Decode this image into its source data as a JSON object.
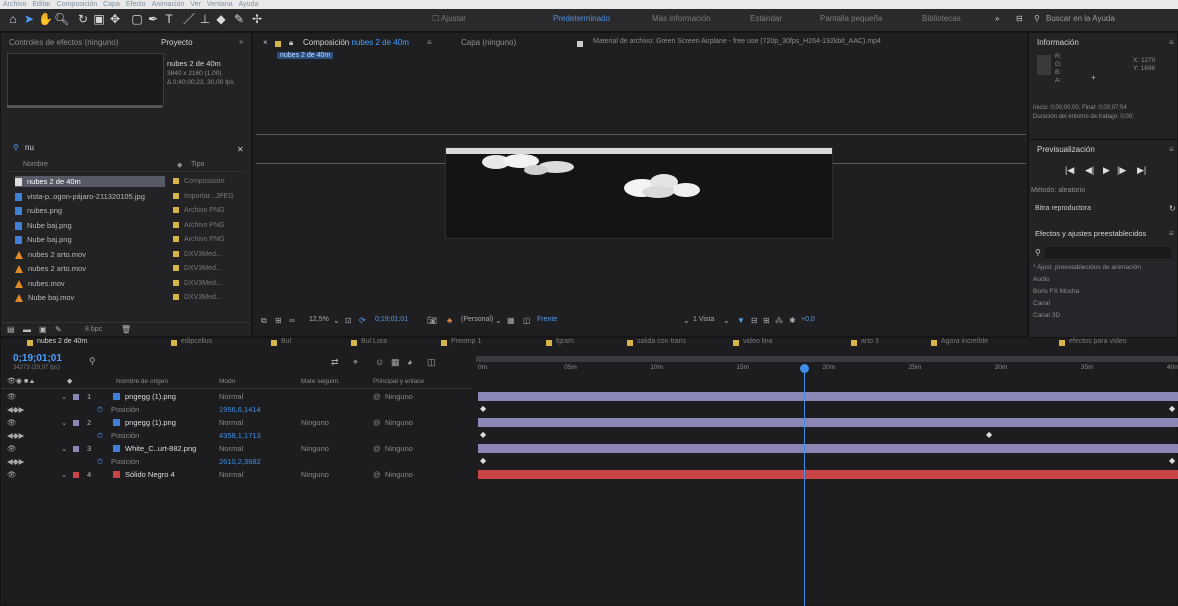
{
  "menu": [
    "Archivo",
    "Editar",
    "Composición",
    "Capa",
    "Efecto",
    "Animación",
    "Ver",
    "Ventana",
    "Ayuda"
  ],
  "toolbar": {
    "tools": [
      "home-icon",
      "selection-tool-icon",
      "hand-tool-icon",
      "zoom-tool-icon",
      "rotate-tool-icon",
      "camera-tool-icon",
      "pan-behind-icon",
      "mask-tool-icon",
      "pen-tool-icon",
      "type-tool-icon",
      "brush-tool-icon",
      "stamp-tool-icon",
      "eraser-tool-icon",
      "roto-brush-icon",
      "puppet-tool-icon"
    ],
    "snap_label": "Ajustar",
    "workspaces": [
      "Predeterminado",
      "Más información",
      "Estándar",
      "Pantalla pequeña",
      "Bibliotecas"
    ],
    "search_placeholder": "Buscar en la Ayuda"
  },
  "project": {
    "tab_effects": "Controles de efectos (ninguno)",
    "tab_project": "Proyecto",
    "selected_name": "nubes 2 de 40m",
    "selected_info": [
      "3840 x 2160 (1,00)",
      "Δ 0;40;00;23, 30,00 fps"
    ],
    "search_value": "nu",
    "col_name": "Nombre",
    "col_type": "Tipo",
    "items": [
      {
        "name": "nubes 2 de 40m",
        "type": "Composición",
        "icon": "comp"
      },
      {
        "name": "vista-p..ogon-pájaro-211320105.jpg",
        "type": "Importar...JPEG",
        "icon": "file"
      },
      {
        "name": "nubes.png",
        "type": "Archivo PNG",
        "icon": "file"
      },
      {
        "name": "Nube baj.png",
        "type": "Archivo PNG",
        "icon": "file"
      },
      {
        "name": "Nube baj.png",
        "type": "Archivo PNG",
        "icon": "file"
      },
      {
        "name": "nubes 2 arto.mov",
        "type": "DXV3Med...",
        "icon": "orange"
      },
      {
        "name": "nubes 2 arto.mov",
        "type": "DXV3Med...",
        "icon": "orange"
      },
      {
        "name": "nubes.mov",
        "type": "DXV3Med...",
        "icon": "orange"
      },
      {
        "name": "Nube baj.mov",
        "type": "DXV3Med...",
        "icon": "orange"
      }
    ],
    "bpc": "8 bpc"
  },
  "viewer": {
    "tab_comp": "Composición",
    "comp_name": "nubes 2 de 40m",
    "tab_layer": "Capa (ninguno)",
    "tab_footage": "Material de archivo: Green Screen Airplane - free use (720p_30fps_H264-192kbit_AAC).mp4",
    "breadcrumb": "nubes 2 de 40m",
    "zoom": "12,5%",
    "timecode": "0;19;01;01",
    "resolution": "(Personal)",
    "view_label": "Frente",
    "views": "1 Vista",
    "exposure": "+0,0"
  },
  "info": {
    "title": "Información",
    "channels": [
      "R:",
      "G:",
      "B:",
      "A:"
    ],
    "coords": [
      "X: 1270",
      "Y: 1698"
    ],
    "time_line": "Inicio: 0;00;00;00, Final: 0;00;07;54",
    "duration_line": "Duración del entorno de trabajo: 0;00;",
    "preview": "Previsualización",
    "method_label": "Método: aleatorio",
    "media_label": "Bitra reproductora",
    "effects_title": "Efectos y ajustes preestablecidos",
    "effects_search": "",
    "effects_items": [
      "* Ajust. preestablecidos de animación",
      "Audio",
      "Boris FX Mocha",
      "Canal",
      "Canal 3D"
    ]
  },
  "timeline": {
    "tabs": [
      "nubes 2 de 40m",
      "edipcellus",
      "Bul",
      "Bul Lora",
      "Preomp 1",
      "fgram",
      "salida con trans",
      "video lina",
      "arto 3",
      "Agora increíble",
      "efectos para vídeo"
    ],
    "timecode": "0;19;01;01",
    "timecode_sub": "34273 (29,97 fps)",
    "search_placeholder": "",
    "columns": {
      "source": "Nombre de origen",
      "mode": "Modo",
      "track": "Mate seguim.",
      "parent": "Principal y enlace"
    },
    "ruler": [
      "0m",
      "05m",
      "10m",
      "15m",
      "20m",
      "25m",
      "30m",
      "35m",
      "40m"
    ],
    "playhead_fraction": 0.466,
    "layers": [
      {
        "num": "1",
        "name": "pngegg (1).png",
        "mode": "Normal",
        "track": "",
        "parent": "Ninguno",
        "color": "#8a86b6",
        "prop": "Posición",
        "value": "1956,6,1414"
      },
      {
        "num": "2",
        "name": "pngegg (1).png",
        "mode": "Normal",
        "track": "Ninguno",
        "parent": "Ninguno",
        "color": "#8a86b6",
        "prop": "Posición",
        "value": "4358,1,1713"
      },
      {
        "num": "3",
        "name": "White_C..urt-882.png",
        "mode": "Normal",
        "track": "Ninguno",
        "parent": "Ninguno",
        "color": "#8a86b6",
        "prop": "Posición",
        "value": "2610,2,3682"
      },
      {
        "num": "4",
        "name": "Sólido Negro 4",
        "mode": "Normal",
        "track": "Ninguno",
        "parent": "Ninguno",
        "color": "#c94545",
        "prop": "",
        "value": ""
      }
    ]
  }
}
